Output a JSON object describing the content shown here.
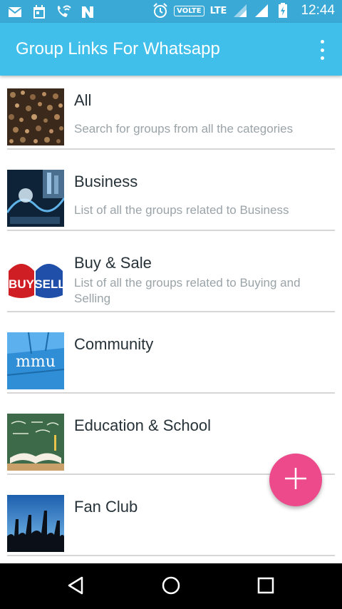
{
  "status_bar": {
    "volte_badge": "VOLTE",
    "network": "LTE",
    "time": "12:44",
    "icons": [
      "mail-icon",
      "calendar-icon",
      "wifi-call-icon",
      "n-icon",
      "alarm-icon",
      "signal-icon",
      "battery-icon"
    ]
  },
  "app_bar": {
    "title": "Group Links For Whatsapp",
    "menu_icon": "more-vert-icon"
  },
  "categories": [
    {
      "title": "All",
      "subtitle": "Search for groups from all the categories"
    },
    {
      "title": "Business",
      "subtitle": "List of all the groups related to Business"
    },
    {
      "title": "Buy & Sale",
      "subtitle": "List of all the groups related to Buying and Selling"
    },
    {
      "title": "Community",
      "subtitle": ""
    },
    {
      "title": "Education & School",
      "subtitle": ""
    },
    {
      "title": "Fan Club",
      "subtitle": ""
    }
  ],
  "fab": {
    "icon": "add-icon",
    "color": "#ec4a8b"
  },
  "nav_bar": {
    "icons": [
      "back-icon",
      "home-icon",
      "recents-icon"
    ]
  },
  "colors": {
    "status_bar": "#3aa9d6",
    "app_bar": "#41bfeb",
    "title_text": "#263238",
    "subtitle_text": "#9aa3a8"
  }
}
